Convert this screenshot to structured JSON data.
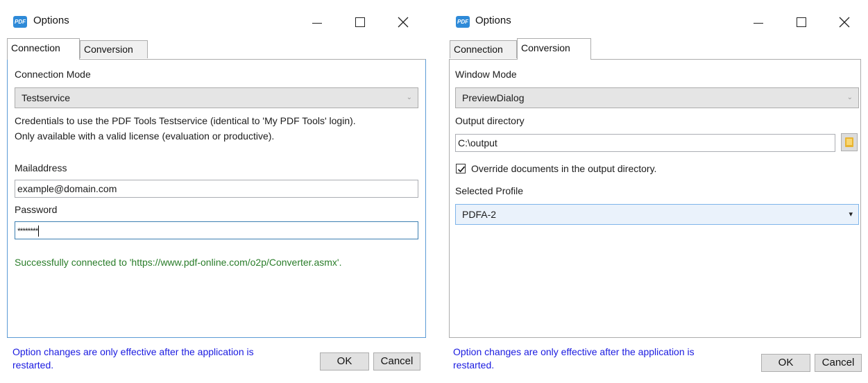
{
  "left": {
    "title": "Options",
    "app_icon": "PDF",
    "tabs": [
      {
        "label": "Connection"
      },
      {
        "label": "Conversion"
      }
    ],
    "connection_mode_label": "Connection Mode",
    "connection_mode_value": "Testservice",
    "description_line1": "Credentials to use the PDF Tools Testservice (identical to 'My PDF Tools' login).",
    "description_line2": "Only available with a valid license (evaluation or productive).",
    "mailaddress_label": "Mailaddress",
    "mailaddress_value": "example@domain.com",
    "password_label": "Password",
    "password_value": "********",
    "status_message": "Successfully connected to 'https://www.pdf-online.com/o2p/Converter.asmx'.",
    "footer_line1": "Option changes are only effective after the application is",
    "footer_line2": "restarted.",
    "ok_label": "OK",
    "cancel_label": "Cancel"
  },
  "right": {
    "title": "Options",
    "app_icon": "PDF",
    "tabs": [
      {
        "label": "Connection"
      },
      {
        "label": "Conversion"
      }
    ],
    "window_mode_label": "Window Mode",
    "window_mode_value": "PreviewDialog",
    "output_directory_label": "Output directory",
    "output_directory_value": "C:\\output",
    "override_label": "Override documents in the output directory.",
    "override_checked": true,
    "selected_profile_label": "Selected Profile",
    "selected_profile_value": "PDFA-2",
    "footer_line1": "Option changes are only effective after the application is",
    "footer_line2": "restarted.",
    "ok_label": "OK",
    "cancel_label": "Cancel"
  },
  "colors": {
    "accent_link": "#1a1ae0",
    "success": "#2a7d2a",
    "focus_border": "#3c7fb1"
  }
}
